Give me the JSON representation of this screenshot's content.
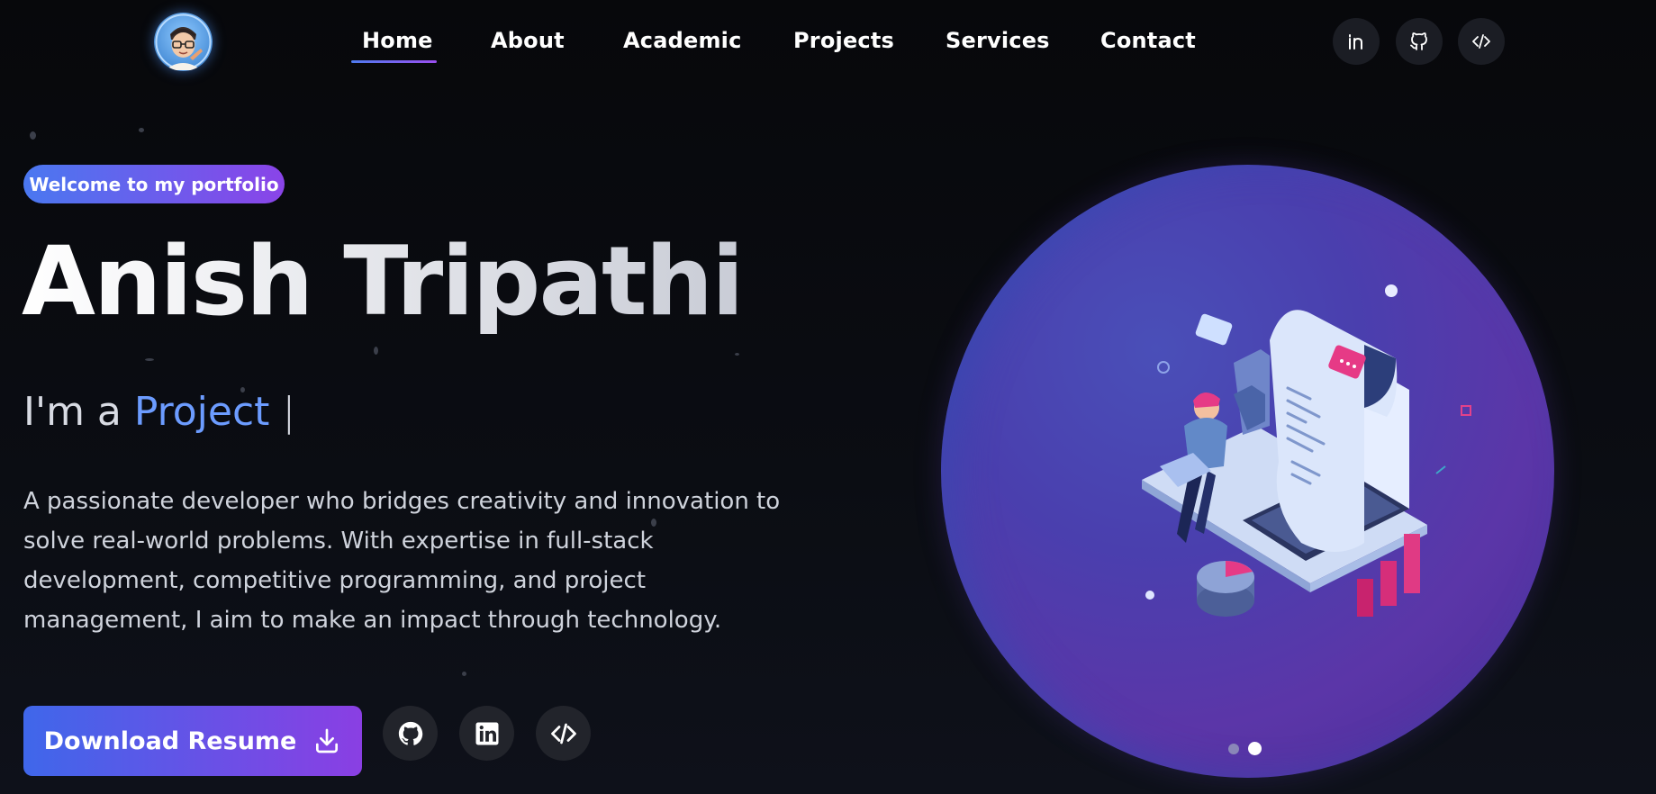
{
  "nav": {
    "links": [
      {
        "label": "Home",
        "active": true
      },
      {
        "label": "About"
      },
      {
        "label": "Academic"
      },
      {
        "label": "Projects"
      },
      {
        "label": "Services"
      },
      {
        "label": "Contact"
      }
    ],
    "icons": [
      "linkedin-icon",
      "github-icon",
      "code-icon"
    ]
  },
  "hero": {
    "badge": "Welcome to my portfolio",
    "name": "Anish Tripathi",
    "role_prefix": "I'm a ",
    "role": "Project",
    "role_cursor": " |",
    "description": "A passionate developer who bridges creativity and innovation to solve real-world problems. With expertise in full-stack development, competitive programming, and project management, I aim to make an impact through technology.",
    "resume_button": "Download Resume",
    "social_icons": [
      "github-icon",
      "linkedin-icon",
      "code-icon"
    ]
  },
  "carousel": {
    "slides": 2,
    "active_index": 1
  },
  "colors": {
    "accent_start": "#4a78f0",
    "accent_end": "#8a44e8",
    "role_text": "#6c9cff",
    "background": "#07080b"
  }
}
